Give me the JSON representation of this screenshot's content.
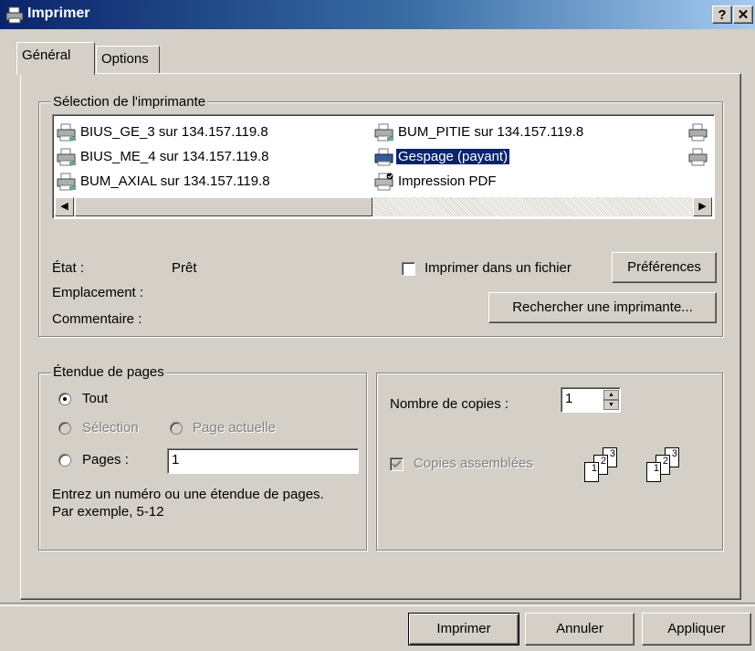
{
  "window": {
    "title": "Imprimer",
    "help_label": "?",
    "close_label": "✕"
  },
  "tabs": [
    {
      "label": "Général"
    },
    {
      "label": "Options"
    }
  ],
  "printer_selection": {
    "group_label": "Sélection de l'imprimante",
    "printers": [
      {
        "name": "BIUS_GE_3 sur 134.157.119.8"
      },
      {
        "name": "BIUS_ME_4 sur 134.157.119.8"
      },
      {
        "name": "BUM_AXIAL sur 134.157.119.8"
      },
      {
        "name": "BUM_PITIE sur 134.157.119.8"
      },
      {
        "name": "Gespage (payant)",
        "selected": true
      },
      {
        "name": "Impression PDF",
        "default": true
      }
    ]
  },
  "status": {
    "state_label": "État :",
    "state_value": "Prêt",
    "location_label": "Emplacement :",
    "comment_label": "Commentaire :",
    "print_to_file_label": "Imprimer dans un fichier",
    "preferences_button": "Préférences",
    "find_printer_button": "Rechercher une imprimante..."
  },
  "page_range": {
    "group_label": "Étendue de pages",
    "all_label": "Tout",
    "selection_label": "Sélection",
    "current_page_label": "Page actuelle",
    "pages_label": "Pages :",
    "pages_value": "1",
    "hint_line1": "Entrez un numéro ou une étendue de pages.",
    "hint_line2": "Par exemple, 5-12"
  },
  "copies": {
    "count_label": "Nombre de copies :",
    "count_value": "1",
    "collate_label": "Copies assemblées",
    "collate_numbers": [
      "1",
      "2",
      "3"
    ]
  },
  "footer": {
    "print_button": "Imprimer",
    "cancel_button": "Annuler",
    "apply_button": "Appliquer"
  }
}
